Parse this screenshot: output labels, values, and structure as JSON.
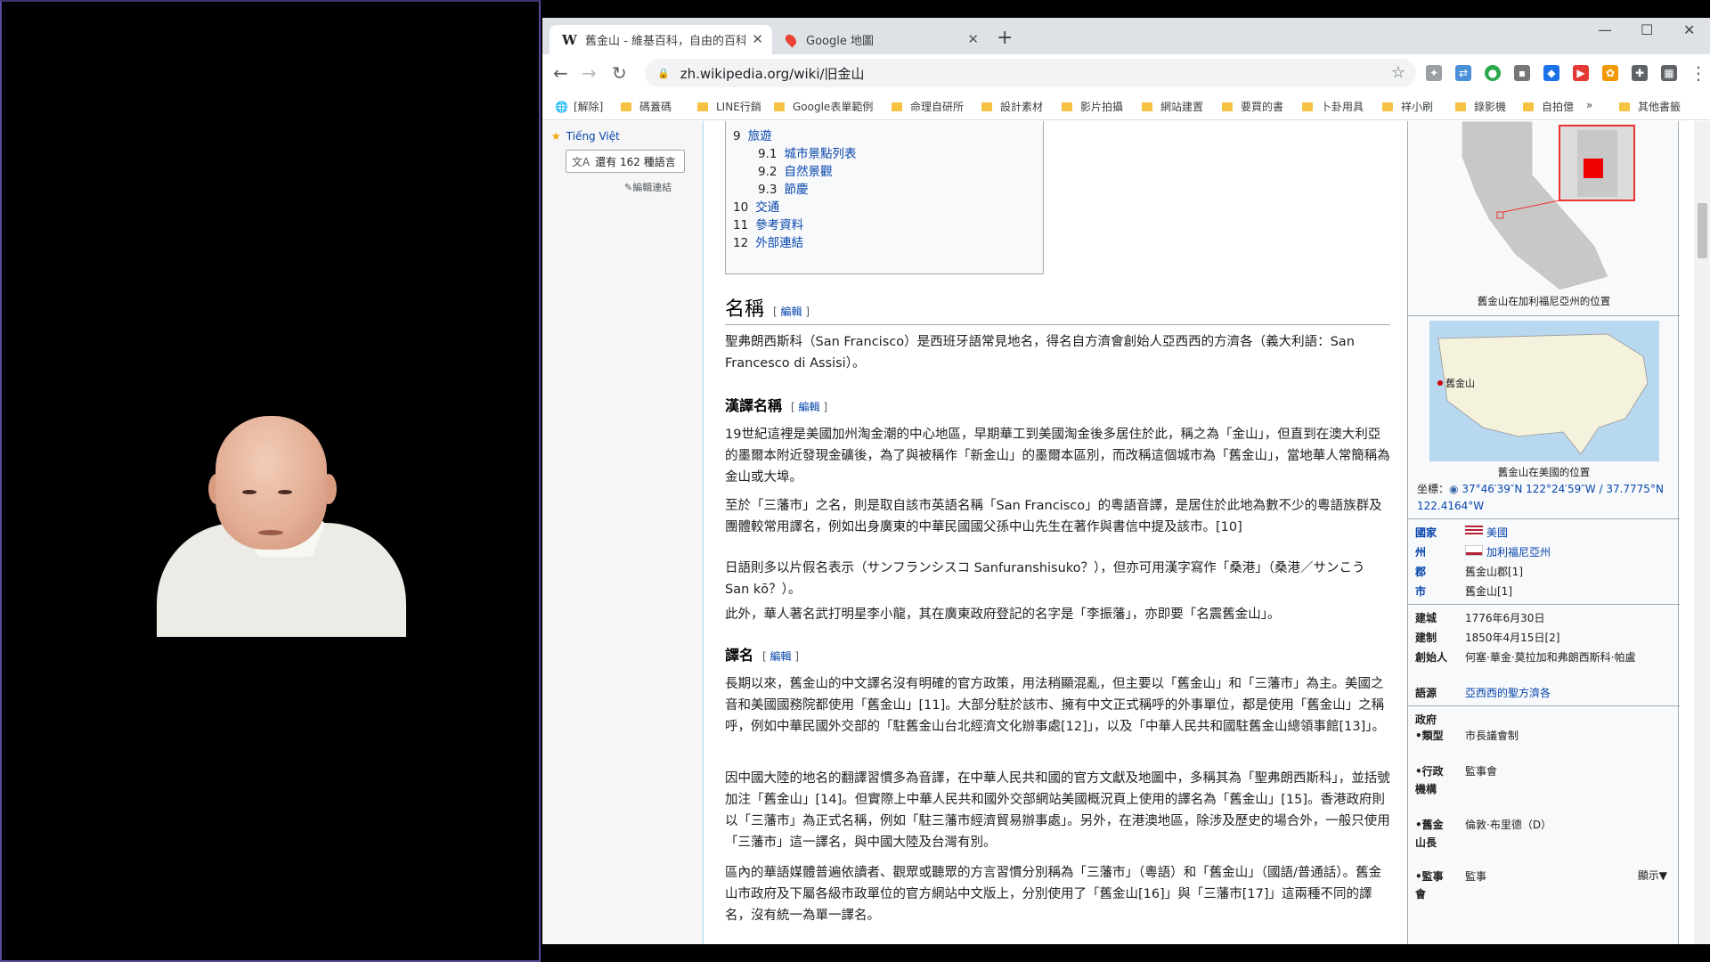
{
  "browser": {
    "tabs": [
      {
        "favicon": "W",
        "title": "舊金山 - 維基百科，自由的百科全書",
        "close": "✕",
        "active": true
      },
      {
        "favicon": "maps-pin",
        "title": "Google 地圖",
        "close": "✕",
        "active": false
      }
    ],
    "new_tab": "+",
    "window": {
      "minimize": "—",
      "maximize": "☐",
      "close": "✕"
    },
    "url": "zh.wikipedia.org/wiki/旧金山",
    "bookmarks": [
      "[解除]",
      "碼蓋碼",
      "LINE行銷",
      "Google表單範例",
      "命理自研所",
      "設計素材",
      "影片拍攝",
      "網站建置",
      "要買的書",
      "卜卦用具",
      "祥小刷",
      "錄影機",
      "自拍億",
      "»",
      "其他書籤"
    ]
  },
  "sidebar": {
    "language": "Tiếng Việt",
    "lang_button": "還有 162 種語言",
    "edit_links": "編輯連結"
  },
  "toc": [
    {
      "num": "9",
      "label": "旅遊",
      "level": 1
    },
    {
      "num": "9.1",
      "label": "城市景點列表",
      "level": 2
    },
    {
      "num": "9.2",
      "label": "自然景觀",
      "level": 2
    },
    {
      "num": "9.3",
      "label": "節慶",
      "level": 2
    },
    {
      "num": "10",
      "label": "交通",
      "level": 1
    },
    {
      "num": "11",
      "label": "參考資料",
      "level": 1
    },
    {
      "num": "12",
      "label": "外部連結",
      "level": 1
    }
  ],
  "article": {
    "edit_label": "編輯",
    "h_name": "名稱",
    "p_name": "聖弗朗西斯科（San Francisco）是西班牙語常見地名，得名自方濟會創始人亞西西的方濟各（義大利語：San Francesco di Assisi）。",
    "h_trans": "漢譯名稱",
    "p_trans1": "19世紀這裡是美國加州淘金潮的中心地區，早期華工到美國淘金後多居住於此，稱之為「金山」，但直到在澳大利亞的墨爾本附近發現金礦後，為了與被稱作「新金山」的墨爾本區別，而改稱這個城市為「舊金山」，當地華人常簡稱為金山或大埠。",
    "p_trans2": "至於「三藩市」之名，則是取自該市英語名稱「San Francisco」的粵語音譯，是居住於此地為數不少的粵語族群及團體較常用譯名，例如出身廣東的中華民國國父孫中山先生在著作與書信中提及該市。[10]",
    "p_trans3": "日語則多以片假名表示（サンフランシスコ Sanfuranshisuko？），但亦可用漢字寫作「桑港」（桑港／サンこう San kō？）。",
    "p_trans4": "此外，華人著名武打明星李小龍，其在廣東政府登記的名字是「李振藩」，亦即要「名震舊金山」。",
    "h_yiming": "譯名",
    "p_y1": "長期以來，舊金山的中文譯名沒有明確的官方政策，用法稍顯混亂，但主要以「舊金山」和「三藩市」為主。美國之音和美國國務院都使用「舊金山」[11]。大部分駐於該市、擁有中文正式稱呼的外事單位，都是使用「舊金山」之稱呼，例如中華民國外交部的「駐舊金山台北經濟文化辦事處[12]」，以及「中華人民共和國駐舊金山總領事館[13]」。",
    "p_y2": "因中國大陸的地名的翻譯習慣多為音譯，在中華人民共和國的官方文獻及地圖中，多稱其為「聖弗朗西斯科」，並括號加注「舊金山」[14]。但實際上中華人民共和國外交部網站美國概況頁上使用的譯名為「舊金山」[15]。香港政府則以「三藩市」為正式名稱，例如「駐三藩市經濟貿易辦事處」。另外，在港澳地區，除涉及歷史的場合外，一般只使用「三藩市」這一譯名，與中國大陸及台灣有別。",
    "p_y3": "區內的華語媒體普遍依讀者、觀眾或聽眾的方言習慣分別稱為「三藩市」（粵語）和「舊金山」（國語/普通話）。舊金山市政府及下屬各級市政單位的官方網站中文版上，分別使用了「舊金山[16]」與「三藩市[17]」這兩種不同的譯名，沒有統一為單一譯名。"
  },
  "infobox": {
    "cap1": "舊金山在加利福尼亞州的位置",
    "cap2": "舊金山在美國的位置",
    "map_label": "舊金山",
    "coord_label": "坐標：",
    "coord": "37°46′39″N 122°24′59″W / 37.7775°N 122.4164°W",
    "rows": [
      {
        "label": "國家",
        "value": "美國",
        "link": true
      },
      {
        "label": "州",
        "value": "加利福尼亞州",
        "link": true
      },
      {
        "label": "郡",
        "value": "舊金山郡[1]",
        "link": false
      },
      {
        "label": "市",
        "value": "舊金山[1]",
        "link": false
      }
    ],
    "rows2": [
      {
        "label": "建城",
        "value": "1776年6月30日"
      },
      {
        "label": "建制",
        "value": "1850年4月15日[2]"
      },
      {
        "label": "創始人",
        "value": "何塞·華金·莫拉加和弗朗西斯科·帕盧"
      },
      {
        "label": "語源",
        "value": "亞西西的聖方濟各"
      }
    ],
    "gov_label": "政府",
    "gov_rows": [
      {
        "label": "•類型",
        "value": "市長議會制"
      },
      {
        "label": "•行政機構",
        "value": "監事會"
      },
      {
        "label": "•舊金山長",
        "value": "倫敦·布里德（D）"
      },
      {
        "label": "•監事會",
        "value": "監事"
      }
    ],
    "show": "顯示▼"
  }
}
